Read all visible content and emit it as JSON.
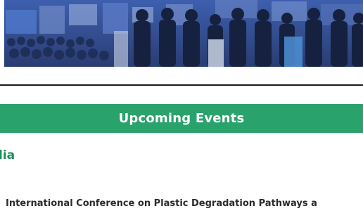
{
  "hero": {
    "image": "conference-crowd-photo",
    "tint": "#3b5aa0"
  },
  "events": {
    "banner_title": "Upcoming Events",
    "banner_color": "#2aa26c",
    "region_heading": "lia",
    "region_color": "#1a8f5a",
    "items": [
      {
        "title": "International Conference on Plastic Degradation Pathways a"
      }
    ]
  }
}
